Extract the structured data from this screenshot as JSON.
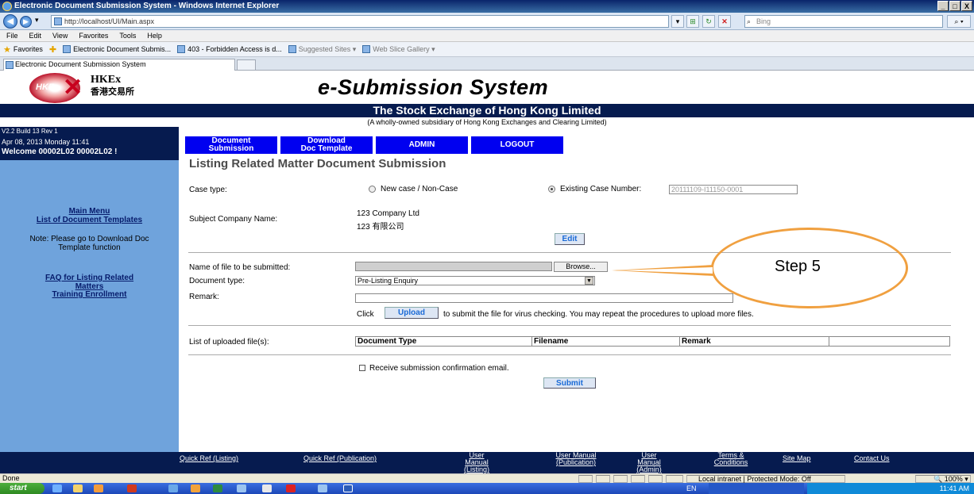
{
  "window": {
    "title": "Electronic Document Submission System - Windows Internet Explorer",
    "buttons": [
      "_",
      "□",
      "X"
    ]
  },
  "browser": {
    "address": "http://localhost/UI/Main.aspx",
    "search_placeholder": "Bing",
    "menu": [
      "File",
      "Edit",
      "View",
      "Favorites",
      "Tools",
      "Help"
    ],
    "favorites_label": "Favorites",
    "favorites_items": [
      "Electronic Document Submis...",
      "403 - Forbidden Access is d...",
      "Suggested Sites ▾",
      "Web Slice Gallery ▾"
    ],
    "tab_title": "Electronic Document Submission System"
  },
  "header": {
    "logo_hkex": "HKEx",
    "logo_chinese": "香港交易所",
    "logo_mark": "HKE",
    "system_title": "e-Submission System",
    "exchange_name": "The Stock Exchange of Hong Kong Limited",
    "exchange_sub": "(A wholly-owned subsidiary of Hong Kong Exchanges and Clearing Limited)"
  },
  "sidebar": {
    "version": "V2.2 Build 13 Rev 1",
    "date": "Apr 08, 2013 Monday 11:41",
    "welcome": "Welcome  00002L02 00002L02 !",
    "main_menu": "Main Menu",
    "list_templates": "List of Document Templates",
    "note": "Note: Please go to Download Doc Template function",
    "faq": "FAQ for Listing Related Matters",
    "training": "Training Enrollment"
  },
  "menu": {
    "document_submission": "Document Submission",
    "download_template": "Download Doc Template",
    "admin": "ADMIN",
    "logout": "LOGOUT"
  },
  "form": {
    "page_title": "Listing Related Matter Document Submission",
    "case_type_label": "Case type:",
    "new_case_label": "New case / Non-Case",
    "existing_case_label": "Existing Case Number:",
    "existing_case_value": "20111109-I11150-0001",
    "subject_label": "Subject Company Name:",
    "company_en": "123 Company Ltd",
    "company_cn": "123 有限公司",
    "edit_button": "Edit",
    "file_label": "Name of file to be submitted:",
    "browse_button": "Browse...",
    "doctype_label": "Document type:",
    "doctype_value": "Pre-Listing Enquiry",
    "remark_label": "Remark:",
    "click_text": "Click",
    "upload_button": "Upload",
    "upload_note": "to submit the file for virus checking. You may repeat the procedures to upload more files.",
    "uploaded_label": "List of uploaded file(s):",
    "table_headers": [
      "Document Type",
      "Filename",
      "Remark",
      ""
    ],
    "email_checkbox": "Receive submission confirmation email.",
    "submit_button": "Submit"
  },
  "annotation": {
    "step": "Step 5",
    "color": "#f0a040"
  },
  "footer": {
    "links": [
      "Quick Ref (Listing)",
      "Quick Ref (Publication)",
      "User Manual (Listing)",
      "User Manual (Publication)",
      "User Manual (Admin)",
      "Terms & Conditions",
      "Site Map",
      "Contact Us"
    ]
  },
  "status": {
    "left": "Done",
    "zone": "Local intranet | Protected Mode: Off",
    "zoom": "100%"
  },
  "taskbar": {
    "start": "start",
    "lang": "EN",
    "time": "11:41 AM"
  }
}
